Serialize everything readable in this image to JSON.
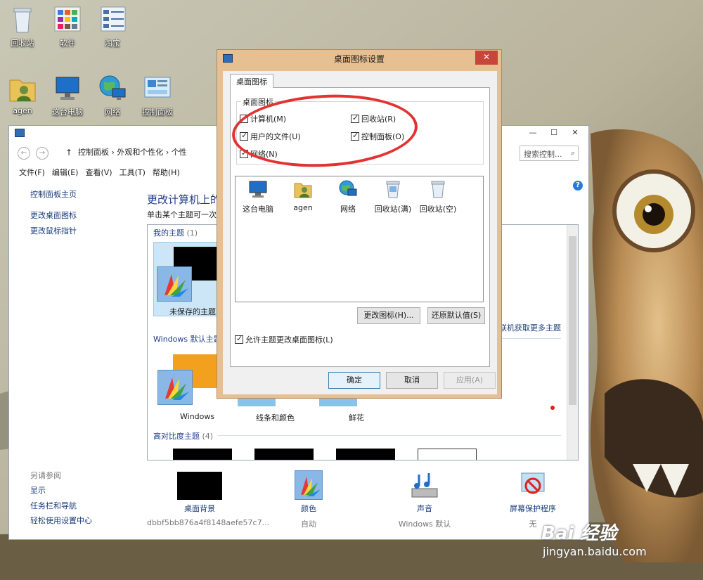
{
  "desktop": {
    "icons": [
      {
        "label": "回收站",
        "icon": "recycle-bin-icon"
      },
      {
        "label": "软件",
        "icon": "apps-grid-icon"
      },
      {
        "label": "淘宝",
        "icon": "list-icon"
      },
      {
        "label": "agen",
        "icon": "user-folder-icon"
      },
      {
        "label": "这台电脑",
        "icon": "computer-icon"
      },
      {
        "label": "网络",
        "icon": "network-globe-icon"
      },
      {
        "label": "控制面板",
        "icon": "control-panel-icon"
      }
    ],
    "watermark": "Bai 经验",
    "watermark_url": "jingyan.baidu.com"
  },
  "explorer": {
    "breadcrumb": [
      "控制面板",
      "外观和个性化",
      "个性"
    ],
    "search_placeholder": "搜索控制...",
    "menu": [
      "文件(F)",
      "编辑(E)",
      "查看(V)",
      "工具(T)",
      "帮助(H)"
    ],
    "sidebar": {
      "home": "控制面板主页",
      "links": [
        "更改桌面图标",
        "更改鼠标指针"
      ],
      "see_also_title": "另请参阅",
      "see_also": [
        "显示",
        "任务栏和导航",
        "轻松使用设置中心"
      ]
    },
    "title": "更改计算机上的视",
    "subtitle": "单击某个主题可一次性",
    "themes": {
      "my_themes": "我的主题",
      "my_themes_count": "(1)",
      "unsaved_theme": "未保存的主题",
      "get_more": "联机获取更多主题",
      "windows_defaults": "Windows 默认主题",
      "default_items": [
        "Windows",
        "线条和颜色",
        "鲜花"
      ],
      "high_contrast": "高对比度主题",
      "high_contrast_count": "(4)"
    },
    "bottom": [
      {
        "label": "桌面背景",
        "sub": "dbbf5bb876a4f8148aefe57c7..."
      },
      {
        "label": "颜色",
        "sub": "自动"
      },
      {
        "label": "声音",
        "sub": "Windows 默认"
      },
      {
        "label": "屏幕保护程序",
        "sub": "无"
      }
    ],
    "help_icon": "?"
  },
  "dialog": {
    "title": "桌面图标设置",
    "close": "✕",
    "tab": "桌面图标",
    "group_title": "桌面图标",
    "checkboxes": [
      {
        "label": "计算机(M)",
        "checked": true
      },
      {
        "label": "回收站(R)",
        "checked": true
      },
      {
        "label": "用户的文件(U)",
        "checked": true
      },
      {
        "label": "控制面板(O)",
        "checked": true
      },
      {
        "label": "网络(N)",
        "checked": true
      }
    ],
    "icons": [
      "这台电脑",
      "agen",
      "网络",
      "回收站(满)",
      "回收站(空)"
    ],
    "change_icon": "更改图标(H)...",
    "restore_default": "还原默认值(S)",
    "allow_themes": "允许主题更改桌面图标(L)",
    "ok": "确定",
    "cancel": "取消",
    "apply": "应用(A)"
  },
  "colors": {
    "dialog_frame": "#e6bf92",
    "close_button": "#c7453a",
    "annotation_circle": "#e23232",
    "link_blue": "#1a3d7a"
  }
}
